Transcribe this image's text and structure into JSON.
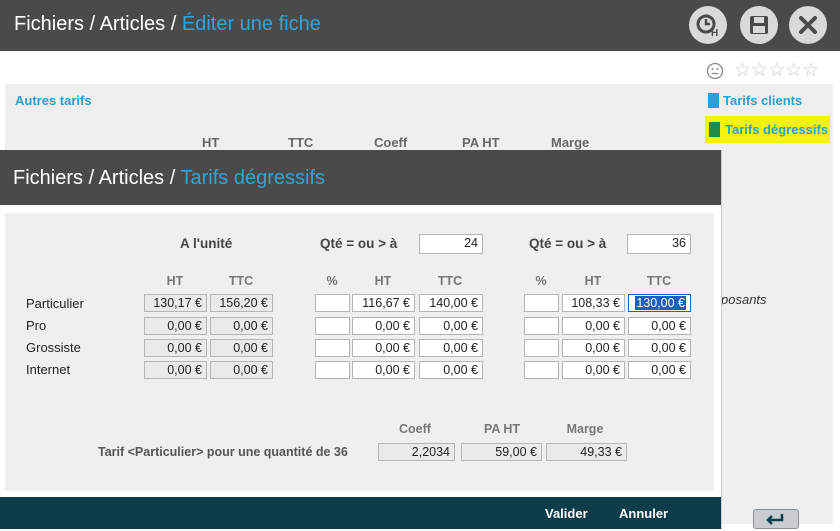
{
  "main": {
    "breadcrumb": {
      "part1": "Fichiers",
      "sep1": "/",
      "part2": "Articles",
      "sep2": "/",
      "current": "Éditer une fiche"
    },
    "section_title": "Autres tarifs",
    "columns": [
      "HT",
      "TTC",
      "Coeff",
      "PA HT",
      "Marge"
    ],
    "right_links": {
      "clients": "Tarifs clients",
      "degressifs": "Tarifs dégressifs"
    },
    "partial_text": "posants",
    "icons": {
      "hold": "clock-hold-icon",
      "save": "save-icon",
      "close": "close-icon",
      "smiley": "smiley-icon",
      "star": "star-icon"
    },
    "stars": 5
  },
  "dialog": {
    "breadcrumb": {
      "part1": "Fichiers",
      "sep1": "/",
      "part2": "Articles",
      "sep2": "/",
      "current": "Tarifs dégressifs"
    },
    "unit_header": "A l'unité",
    "qty_label": "Qté = ou > à",
    "qty1": "24",
    "qty2": "36",
    "col_ht": "HT",
    "col_ttc": "TTC",
    "col_pct": "%",
    "rows": [
      {
        "label": "Particulier",
        "ht": "130,17 €",
        "ttc": "156,20 €",
        "pct1": "",
        "ht1": "116,67 €",
        "ttc1": "140,00 €",
        "pct2": "",
        "ht2": "108,33 €",
        "ttc2": "130,00 €"
      },
      {
        "label": "Pro",
        "ht": "0,00 €",
        "ttc": "0,00 €",
        "pct1": "",
        "ht1": "0,00 €",
        "ttc1": "0,00 €",
        "pct2": "",
        "ht2": "0,00 €",
        "ttc2": "0,00 €"
      },
      {
        "label": "Grossiste",
        "ht": "0,00 €",
        "ttc": "0,00 €",
        "pct1": "",
        "ht1": "0,00 €",
        "ttc1": "0,00 €",
        "pct2": "",
        "ht2": "0,00 €",
        "ttc2": "0,00 €"
      },
      {
        "label": "Internet",
        "ht": "0,00 €",
        "ttc": "0,00 €",
        "pct1": "",
        "ht1": "0,00 €",
        "ttc1": "0,00 €",
        "pct2": "",
        "ht2": "0,00 €",
        "ttc2": "0,00 €"
      }
    ],
    "summary": {
      "label": "Tarif <Particulier> pour une quantité de 36",
      "coeff_label": "Coeff",
      "pa_label": "PA HT",
      "marge_label": "Marge",
      "coeff": "2,2034",
      "pa": "59,00 €",
      "marge": "49,33 €"
    },
    "buttons": {
      "valider": "Valider",
      "annuler": "Annuler"
    }
  },
  "colors": {
    "accent": "#2fa5d8",
    "bar": "#4a4a4a",
    "footer": "#0d3c4a",
    "highlight": "#f4f40a"
  }
}
